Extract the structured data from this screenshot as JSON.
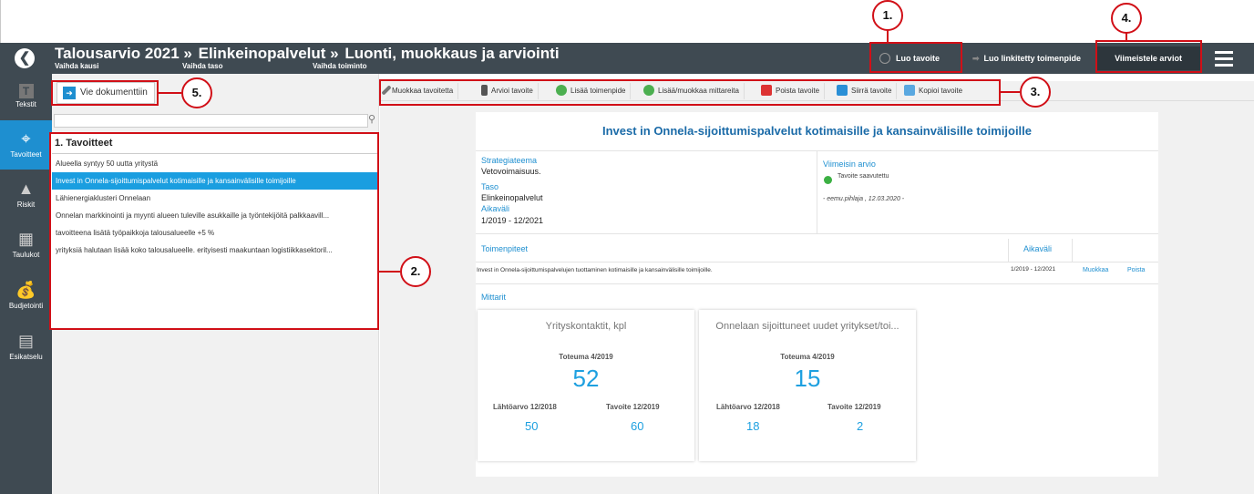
{
  "header": {
    "crumb1": "Talousarvio 2021 »",
    "crumb2": "Elinkeinopalvelut »",
    "crumb3": "Luonti, muokkaus ja arviointi",
    "sub1": "Vaihda kausi",
    "sub2": "Vaihda taso",
    "sub3": "Vaihda toiminto",
    "luo_tavoite": "Luo tavoite",
    "luo_linkitetty": "Luo linkitetty toimenpide",
    "viimeistele": "Viimeistele arviot"
  },
  "nav": [
    {
      "label": "Tekstit",
      "icon": "text-icon"
    },
    {
      "label": "Tavoitteet",
      "icon": "target-icon"
    },
    {
      "label": "Riskit",
      "icon": "warning-icon"
    },
    {
      "label": "Taulukot",
      "icon": "table-icon"
    },
    {
      "label": "Budjetointi",
      "icon": "money-bag-icon"
    },
    {
      "label": "Esikatselu",
      "icon": "preview-icon"
    }
  ],
  "left": {
    "vie_dokumenttiin": "Vie dokumenttiin",
    "search_placeholder": "",
    "goals_title": "1. Tavoitteet",
    "goals": [
      "Alueella syntyy 50 uutta yritystä",
      "Invest in Onnela-sijoittumispalvelut kotimaisille ja kansainvälisille toimijoille",
      "Lähienergiaklusteri Onnelaan",
      "Onnelan markkinointi ja myynti alueen tuleville asukkaille ja työntekijöitä palkkaavill...",
      "tavoitteena lisätä työpaikkoja talousalueelle +5 %",
      "yrityksiä halutaan lisää koko talousalueelle. erityisesti maakuntaan logistiikkasektoril..."
    ]
  },
  "toolbar": [
    "Muokkaa tavoitetta",
    "Arvioi tavoite",
    "Lisää toimenpide",
    "Lisää/muokkaa mittareita",
    "Poista tavoite",
    "Siirrä tavoite",
    "Kopioi tavoite"
  ],
  "detail": {
    "title": "Invest in Onnela-sijoittumispalvelut kotimaisille ja kansainvälisille toimijoille",
    "strategiateema_label": "Strategiateema",
    "strategiateema": "Vetovoimaisuus.",
    "taso_label": "Taso",
    "taso": "Elinkeinopalvelut",
    "aikavali_label": "Aikaväli",
    "aikavali": "1/2019 - 12/2021",
    "viimeisin_label": "Viimeisin arvio",
    "viimeisin_status": "Tavoite saavutettu",
    "viimeisin_author": "- eemu.pihlaja , 12.03.2020 -",
    "toimenpiteet_label": "Toimenpiteet",
    "toimenpiteet_aikavali_label": "Aikaväli",
    "toimenpide_text": "Invest in Onnela-sijoittumispalvelujen tuottaminen kotimaisille ja kansainvälisille toimijoille.",
    "toimenpide_aikavali": "1/2019 - 12/2021",
    "muokkaa": "Muokkaa",
    "poista": "Poista",
    "mittarit_label": "Mittarit"
  },
  "metrics": [
    {
      "title": "Yrityskontaktit, kpl",
      "toteuma_label": "Toteuma 4/2019",
      "toteuma": "52",
      "lahto_label": "Lähtöarvo 12/2018",
      "lahto": "50",
      "tavoite_label": "Tavoite 12/2019",
      "tavoite": "60"
    },
    {
      "title": "Onnelaan sijoittuneet uudet yritykset/toi...",
      "toteuma_label": "Toteuma 4/2019",
      "toteuma": "15",
      "lahto_label": "Lähtöarvo 12/2018",
      "lahto": "18",
      "tavoite_label": "Tavoite 12/2019",
      "tavoite": "2"
    }
  ],
  "annotations": [
    "1.",
    "2.",
    "3.",
    "4.",
    "5."
  ],
  "colors": {
    "header": "#3f4a52",
    "accent": "#1e8fd0",
    "annotation": "#d10f17"
  }
}
